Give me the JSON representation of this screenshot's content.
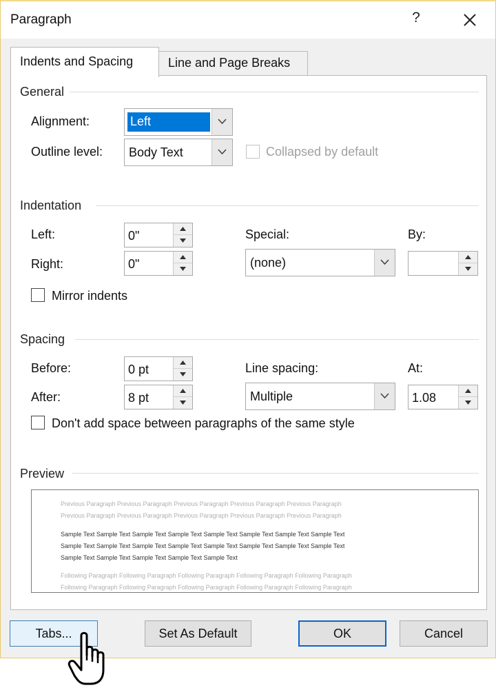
{
  "window": {
    "title": "Paragraph",
    "help_glyph": "?",
    "close_icon": "close-icon"
  },
  "tabs": [
    {
      "label": "Indents and Spacing",
      "active": true
    },
    {
      "label": "Line and Page Breaks",
      "active": false
    }
  ],
  "general": {
    "header": "General",
    "alignment_label": "Alignment:",
    "alignment_value": "Left",
    "outline_label": "Outline level:",
    "outline_value": "Body Text",
    "collapsed_label": "Collapsed by default",
    "collapsed_checked": false
  },
  "indentation": {
    "header": "Indentation",
    "left_label": "Left:",
    "left_value": "0\"",
    "right_label": "Right:",
    "right_value": "0\"",
    "special_label": "Special:",
    "special_value": "(none)",
    "by_label": "By:",
    "by_value": "",
    "mirror_label": "Mirror indents",
    "mirror_checked": false
  },
  "spacing": {
    "header": "Spacing",
    "before_label": "Before:",
    "before_value": "0 pt",
    "after_label": "After:",
    "after_value": "8 pt",
    "line_spacing_label": "Line spacing:",
    "line_spacing_value": "Multiple",
    "at_label": "At:",
    "at_value": "1.08",
    "dont_add_label": "Don't add space between paragraphs of the same style",
    "dont_add_checked": false
  },
  "preview": {
    "header": "Preview",
    "previous_lines": [
      "Previous Paragraph Previous Paragraph Previous Paragraph Previous Paragraph Previous Paragraph",
      "Previous Paragraph Previous Paragraph Previous Paragraph Previous Paragraph Previous Paragraph"
    ],
    "sample_lines": [
      "Sample Text Sample Text Sample Text Sample Text Sample Text Sample Text Sample Text Sample Text",
      "Sample Text Sample Text Sample Text Sample Text Sample Text Sample Text Sample Text Sample Text",
      "Sample Text Sample Text Sample Text Sample Text Sample Text"
    ],
    "following_lines": [
      "Following Paragraph Following Paragraph Following Paragraph Following Paragraph Following Paragraph",
      "Following Paragraph Following Paragraph Following Paragraph Following Paragraph Following Paragraph"
    ]
  },
  "buttons": {
    "tabs": "Tabs...",
    "set_default": "Set As Default",
    "ok": "OK",
    "cancel": "Cancel"
  },
  "colors": {
    "selection": "#0078d7",
    "focus_border": "#0a64c8",
    "dialog_bg": "#f0f0f0"
  }
}
